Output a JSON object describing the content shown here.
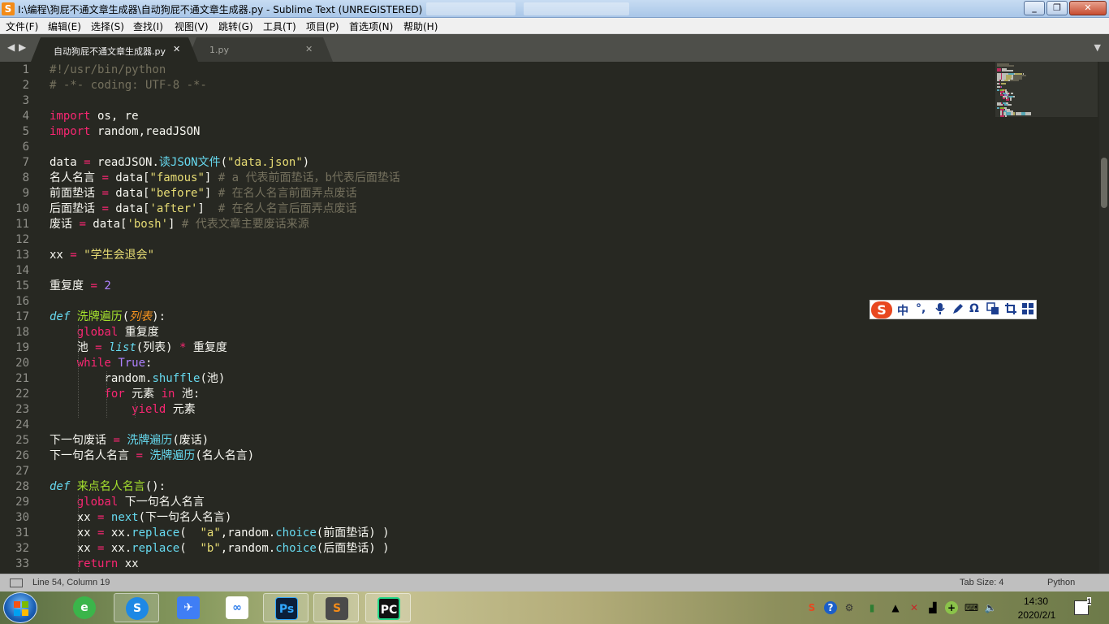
{
  "window": {
    "title": "I:\\编程\\狗屁不通文章生成器\\自动狗屁不通文章生成器.py - Sublime Text (UNREGISTERED)"
  },
  "menu": [
    "文件(F)",
    "编辑(E)",
    "选择(S)",
    "查找(I)",
    "视图(V)",
    "跳转(G)",
    "工具(T)",
    "项目(P)",
    "首选项(N)",
    "帮助(H)"
  ],
  "tabs": [
    {
      "label": "自动狗屁不通文章生成器.py",
      "active": true
    },
    {
      "label": "1.py",
      "active": false
    }
  ],
  "editor": {
    "lines": [
      [
        {
          "t": "#!/usr/bin/python",
          "c": "comment"
        }
      ],
      [
        {
          "t": "# -*- coding: UTF-8 -*-",
          "c": "comment"
        }
      ],
      [],
      [
        {
          "t": "import",
          "c": "keyword"
        },
        {
          "t": " os, re",
          "c": "plain"
        }
      ],
      [
        {
          "t": "import",
          "c": "keyword"
        },
        {
          "t": " random,readJSON",
          "c": "plain"
        }
      ],
      [],
      [
        {
          "t": "data ",
          "c": "plain"
        },
        {
          "t": "=",
          "c": "keyword"
        },
        {
          "t": " readJSON.",
          "c": "plain"
        },
        {
          "t": "读JSON文件",
          "c": "func"
        },
        {
          "t": "(",
          "c": "plain"
        },
        {
          "t": "\"data.json\"",
          "c": "string"
        },
        {
          "t": ")",
          "c": "plain"
        }
      ],
      [
        {
          "t": "名人名言 ",
          "c": "plain"
        },
        {
          "t": "=",
          "c": "keyword"
        },
        {
          "t": " data[",
          "c": "plain"
        },
        {
          "t": "\"famous\"",
          "c": "string"
        },
        {
          "t": "] ",
          "c": "plain"
        },
        {
          "t": "# a 代表前面垫话，b代表后面垫话",
          "c": "comment"
        }
      ],
      [
        {
          "t": "前面垫话 ",
          "c": "plain"
        },
        {
          "t": "=",
          "c": "keyword"
        },
        {
          "t": " data[",
          "c": "plain"
        },
        {
          "t": "\"before\"",
          "c": "string"
        },
        {
          "t": "] ",
          "c": "plain"
        },
        {
          "t": "# 在名人名言前面弄点废话",
          "c": "comment"
        }
      ],
      [
        {
          "t": "后面垫话 ",
          "c": "plain"
        },
        {
          "t": "=",
          "c": "keyword"
        },
        {
          "t": " data[",
          "c": "plain"
        },
        {
          "t": "'after'",
          "c": "string"
        },
        {
          "t": "]  ",
          "c": "plain"
        },
        {
          "t": "# 在名人名言后面弄点废话",
          "c": "comment"
        }
      ],
      [
        {
          "t": "废话 ",
          "c": "plain"
        },
        {
          "t": "=",
          "c": "keyword"
        },
        {
          "t": " data[",
          "c": "plain"
        },
        {
          "t": "'bosh'",
          "c": "string"
        },
        {
          "t": "] ",
          "c": "plain"
        },
        {
          "t": "# 代表文章主要废话来源",
          "c": "comment"
        }
      ],
      [],
      [
        {
          "t": "xx ",
          "c": "plain"
        },
        {
          "t": "=",
          "c": "keyword"
        },
        {
          "t": " ",
          "c": "plain"
        },
        {
          "t": "\"学生会退会\"",
          "c": "string"
        }
      ],
      [],
      [
        {
          "t": "重复度 ",
          "c": "plain"
        },
        {
          "t": "=",
          "c": "keyword"
        },
        {
          "t": " ",
          "c": "plain"
        },
        {
          "t": "2",
          "c": "number"
        }
      ],
      [],
      [
        {
          "t": "def",
          "c": "storage"
        },
        {
          "t": " ",
          "c": "plain"
        },
        {
          "t": "洗牌遍历",
          "c": "defname"
        },
        {
          "t": "(",
          "c": "plain"
        },
        {
          "t": "列表",
          "c": "param"
        },
        {
          "t": "):",
          "c": "plain"
        }
      ],
      [
        {
          "t": "    ",
          "c": "plain"
        },
        {
          "t": "global",
          "c": "keyword"
        },
        {
          "t": " 重复度",
          "c": "plain"
        }
      ],
      [
        {
          "t": "    池 ",
          "c": "plain"
        },
        {
          "t": "=",
          "c": "keyword"
        },
        {
          "t": " ",
          "c": "plain"
        },
        {
          "t": "list",
          "c": "storage"
        },
        {
          "t": "(列表) ",
          "c": "plain"
        },
        {
          "t": "*",
          "c": "keyword"
        },
        {
          "t": " 重复度",
          "c": "plain"
        }
      ],
      [
        {
          "t": "    ",
          "c": "plain"
        },
        {
          "t": "while",
          "c": "keyword"
        },
        {
          "t": " ",
          "c": "plain"
        },
        {
          "t": "True",
          "c": "number"
        },
        {
          "t": ":",
          "c": "plain"
        }
      ],
      [
        {
          "t": "        random.",
          "c": "plain"
        },
        {
          "t": "shuffle",
          "c": "func"
        },
        {
          "t": "(池)",
          "c": "plain"
        }
      ],
      [
        {
          "t": "        ",
          "c": "plain"
        },
        {
          "t": "for",
          "c": "keyword"
        },
        {
          "t": " 元素 ",
          "c": "plain"
        },
        {
          "t": "in",
          "c": "keyword"
        },
        {
          "t": " 池:",
          "c": "plain"
        }
      ],
      [
        {
          "t": "            ",
          "c": "plain"
        },
        {
          "t": "yield",
          "c": "keyword"
        },
        {
          "t": " 元素",
          "c": "plain"
        }
      ],
      [],
      [
        {
          "t": "下一句废话 ",
          "c": "plain"
        },
        {
          "t": "=",
          "c": "keyword"
        },
        {
          "t": " ",
          "c": "plain"
        },
        {
          "t": "洗牌遍历",
          "c": "func"
        },
        {
          "t": "(废话)",
          "c": "plain"
        }
      ],
      [
        {
          "t": "下一句名人名言 ",
          "c": "plain"
        },
        {
          "t": "=",
          "c": "keyword"
        },
        {
          "t": " ",
          "c": "plain"
        },
        {
          "t": "洗牌遍历",
          "c": "func"
        },
        {
          "t": "(名人名言)",
          "c": "plain"
        }
      ],
      [],
      [
        {
          "t": "def",
          "c": "storage"
        },
        {
          "t": " ",
          "c": "plain"
        },
        {
          "t": "来点名人名言",
          "c": "defname"
        },
        {
          "t": "():",
          "c": "plain"
        }
      ],
      [
        {
          "t": "    ",
          "c": "plain"
        },
        {
          "t": "global",
          "c": "keyword"
        },
        {
          "t": " 下一句名人名言",
          "c": "plain"
        }
      ],
      [
        {
          "t": "    xx ",
          "c": "plain"
        },
        {
          "t": "=",
          "c": "keyword"
        },
        {
          "t": " ",
          "c": "plain"
        },
        {
          "t": "next",
          "c": "func"
        },
        {
          "t": "(下一句名人名言)",
          "c": "plain"
        }
      ],
      [
        {
          "t": "    xx ",
          "c": "plain"
        },
        {
          "t": "=",
          "c": "keyword"
        },
        {
          "t": " xx.",
          "c": "plain"
        },
        {
          "t": "replace",
          "c": "func"
        },
        {
          "t": "(  ",
          "c": "plain"
        },
        {
          "t": "\"a\"",
          "c": "string"
        },
        {
          "t": ",random.",
          "c": "plain"
        },
        {
          "t": "choice",
          "c": "func"
        },
        {
          "t": "(前面垫话) )",
          "c": "plain"
        }
      ],
      [
        {
          "t": "    xx ",
          "c": "plain"
        },
        {
          "t": "=",
          "c": "keyword"
        },
        {
          "t": " xx.",
          "c": "plain"
        },
        {
          "t": "replace",
          "c": "func"
        },
        {
          "t": "(  ",
          "c": "plain"
        },
        {
          "t": "\"b\"",
          "c": "string"
        },
        {
          "t": ",random.",
          "c": "plain"
        },
        {
          "t": "choice",
          "c": "func"
        },
        {
          "t": "(后面垫话) )",
          "c": "plain"
        }
      ],
      [
        {
          "t": "    ",
          "c": "plain"
        },
        {
          "t": "return",
          "c": "keyword"
        },
        {
          "t": " xx",
          "c": "plain"
        }
      ]
    ],
    "colors": {
      "comment": "#75715e",
      "keyword": "#f92672",
      "string": "#e6db74",
      "number": "#ae81ff",
      "func": "#66d9ef",
      "storage": "#66d9ef",
      "defname": "#a6e22e",
      "param": "#fd971f",
      "plain": "#f8f8f2"
    }
  },
  "ime_toolbar": {
    "logo": "S",
    "items": [
      "中",
      "°,",
      "mic-icon",
      "pen-icon",
      "Ω",
      "translate-icon",
      "crop-icon",
      "grid-icon"
    ]
  },
  "statusbar": {
    "position": "Line 54, Column 19",
    "tab_size": "Tab Size: 4",
    "syntax": "Python"
  },
  "taskbar": {
    "apps": [
      "ie-icon",
      "sogou-browser-icon",
      "feishu-icon",
      "baidu-netdisk-icon",
      "photoshop-icon",
      "sublime-icon",
      "pycharm-icon"
    ],
    "clock_time": "14:30",
    "clock_date": "2020/2/1",
    "notification_count": "1"
  }
}
